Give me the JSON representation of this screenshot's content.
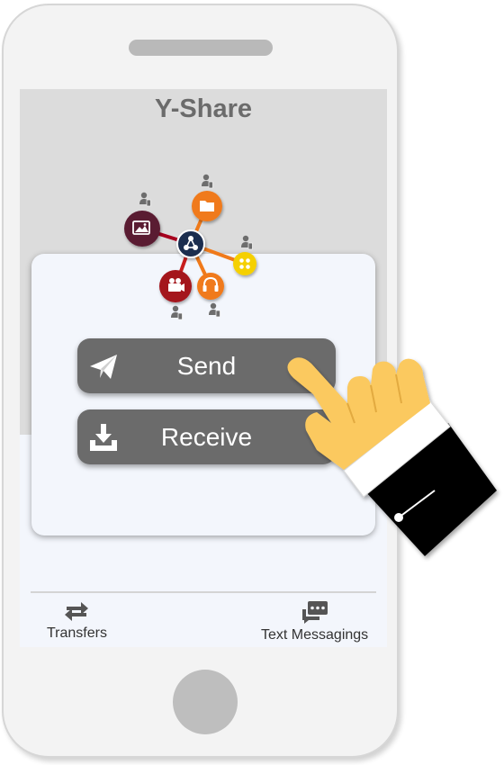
{
  "app": {
    "title": "Y-Share"
  },
  "actions": {
    "send_label": "Send",
    "receive_label": "Receive"
  },
  "bottom_nav": {
    "transfers_label": "Transfers",
    "messages_label": "Text Messagings"
  },
  "icons": {
    "network_center": "share-hub-icon",
    "nodes": [
      "photo-icon",
      "folder-icon",
      "apps-icon",
      "headphones-icon",
      "video-camera-icon"
    ],
    "send": "paper-plane-icon",
    "receive": "download-tray-icon",
    "transfers": "swap-arrows-icon",
    "messages": "chat-bubbles-icon"
  },
  "colors": {
    "header_bg": "#dcdcdc",
    "button_bg": "#6b6b6b",
    "hub": "#1f2d4f",
    "photo_node": "#5a1a32",
    "folder_node": "#f07a1a",
    "apps_node": "#f5d000",
    "headphones_node": "#f07a1a",
    "video_node": "#a4121c",
    "hand": "#fbc95f",
    "cuff": "#ffffff",
    "sleeve": "#000000"
  }
}
